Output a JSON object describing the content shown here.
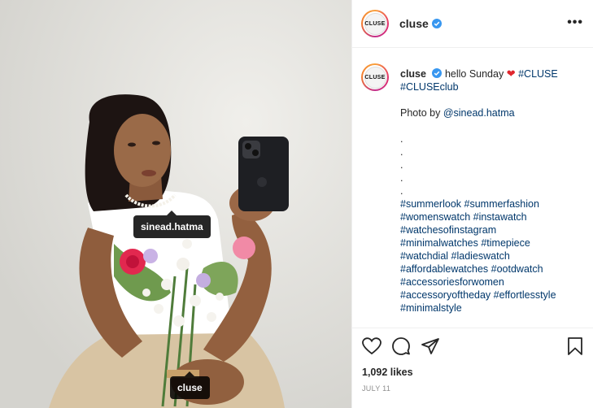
{
  "photo": {
    "tags": {
      "person": "sinead.hatma",
      "brand": "cluse"
    }
  },
  "header": {
    "avatar_text": "CLUSE",
    "username": "cluse",
    "more_label": "•••"
  },
  "caption": {
    "username": "cluse",
    "text": "hello Sunday",
    "heart": "❤",
    "hashtags_inline": [
      "#CLUSE",
      "#CLUSEclub"
    ],
    "photo_by_prefix": "Photo by ",
    "photo_by_handle": "@sinead.hatma",
    "dots": [
      ".",
      ".",
      ".",
      ".",
      "."
    ],
    "hashtag_lines": [
      "#summerlook #summerfashion",
      "#womenswatch #instawatch",
      "#watchesofinstagram",
      "#minimalwatches #timepiece",
      "#watchdial #ladieswatch",
      "#affordablewatches #ootdwatch",
      "#accessoriesforwomen",
      "#accessoryoftheday #effortlesstyle",
      "#minimalstyle"
    ]
  },
  "footer": {
    "likes": "1,092 likes",
    "date": "JULY 11"
  },
  "colors": {
    "link": "#00376b",
    "verified": "#3897f0",
    "heart": "#e0262e"
  }
}
